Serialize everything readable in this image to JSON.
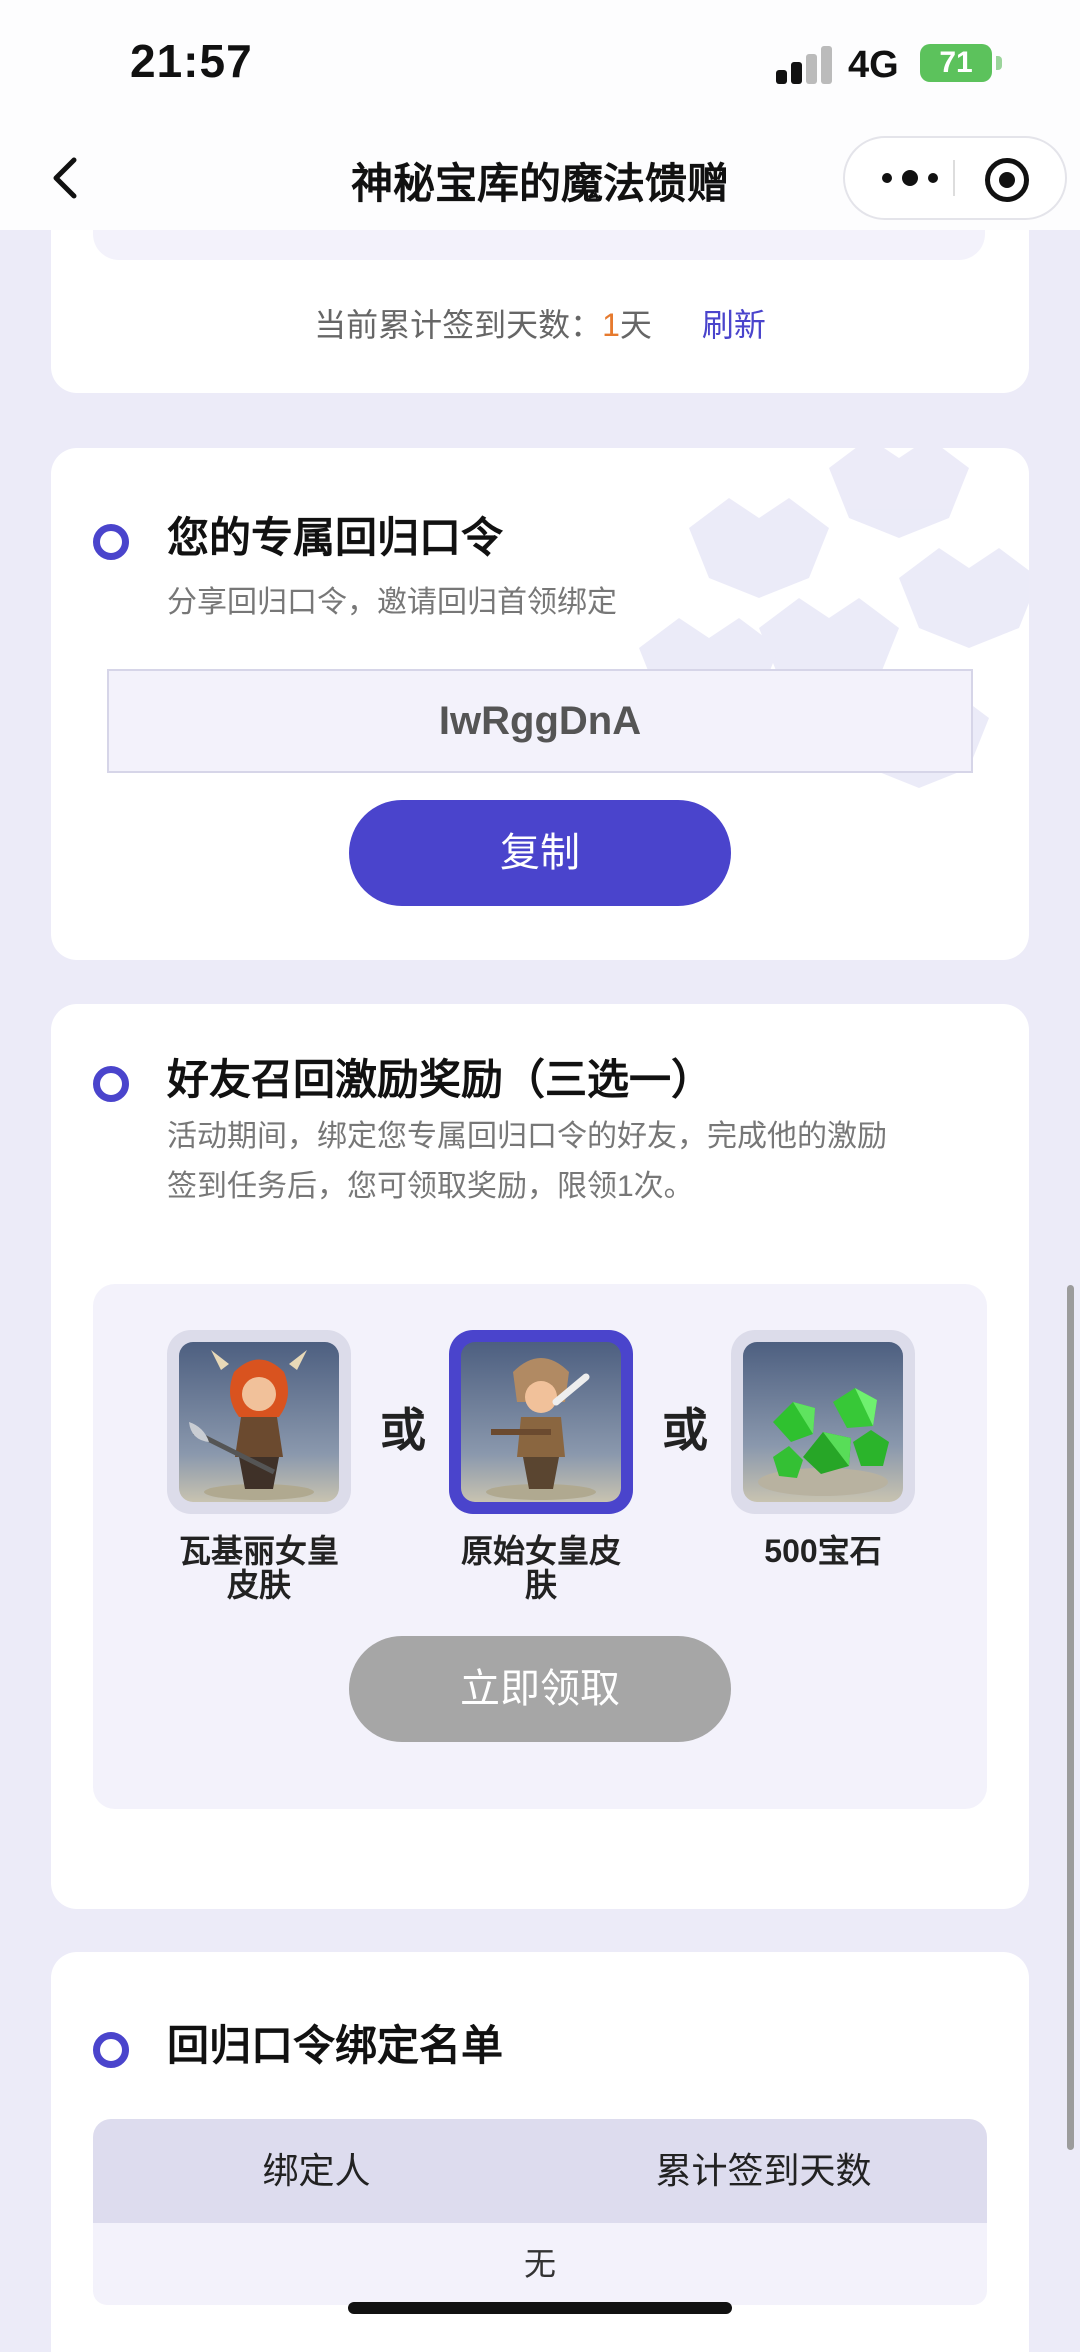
{
  "status_bar": {
    "time": "21:57",
    "network": "4G",
    "battery": "71"
  },
  "nav": {
    "title": "神秘宝库的魔法馈赠",
    "back_icon": "chevron-left-icon",
    "more_icon": "more-dots-icon",
    "target_icon": "target-icon"
  },
  "checkin": {
    "label": "当前累计签到天数：",
    "days": "1",
    "unit": "天",
    "refresh": "刷新"
  },
  "invite": {
    "title": "您的专属回归口令",
    "desc": "分享回归口令，邀请回归首领绑定",
    "code": "IwRggDnA",
    "copy_button": "复制"
  },
  "rewards": {
    "title": "好友召回激励奖励（三选一）",
    "desc_line1": "活动期间，绑定您专属回归口令的好友，完成他的激励",
    "desc_line2": "签到任务后，您可领取奖励，限领1次。",
    "or_label": "或",
    "items": [
      {
        "label_line1": "瓦基丽女皇",
        "label_line2": "皮肤",
        "selected": false
      },
      {
        "label_line1": "原始女皇皮",
        "label_line2": "肤",
        "selected": true
      },
      {
        "label_line1": "500宝石",
        "label_line2": "",
        "selected": false
      }
    ],
    "claim_button": "立即领取"
  },
  "binding_list": {
    "title": "回归口令绑定名单",
    "columns": [
      "绑定人",
      "累计签到天数"
    ],
    "empty_text": "无"
  },
  "colors": {
    "accent": "#4a44cc",
    "highlight": "#e67a2e",
    "disabled": "#a6a6a6"
  }
}
